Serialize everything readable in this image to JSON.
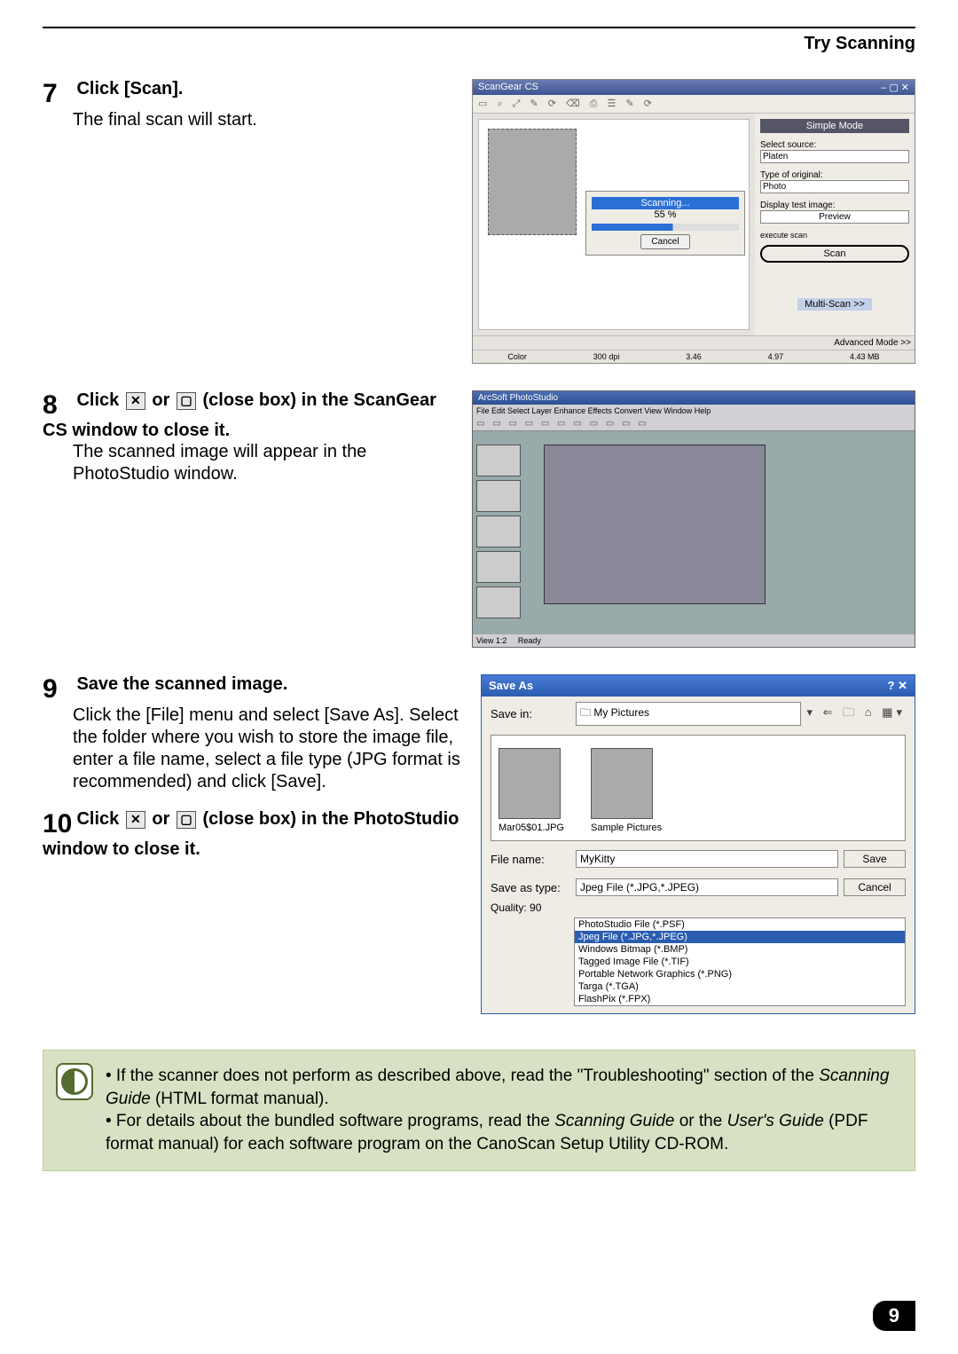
{
  "header": {
    "title": "Try Scanning"
  },
  "steps": {
    "s7": {
      "num": "7",
      "bold": "Click [Scan].",
      "body": "The final scan will start."
    },
    "s8": {
      "num": "8",
      "bold_a": "Click ",
      "bold_b": " or ",
      "bold_c": " (close box) in the ScanGear CS window to close it.",
      "body": "The scanned image will appear in the PhotoStudio window."
    },
    "s9": {
      "num": "9",
      "bold": "Save the scanned image.",
      "body": "Click the [File] menu and select [Save As]. Select the folder where you wish to store the image file, enter a file name, select a file type (JPG format is recommended) and click [Save]."
    },
    "s10": {
      "num": "10",
      "bold_a": "Click ",
      "bold_b": " or ",
      "bold_c": " (close box) in the PhotoStudio window to close it."
    }
  },
  "scangear": {
    "title": "ScanGear CS",
    "toolbar": "▭ ⌕ ⤢  ✎ ⟳ ⌫ ⎙ ☰ ✎ ⟳",
    "mode": "Simple Mode",
    "select_source_label": "Select source:",
    "select_source_value": "Platen",
    "type_original_label": "Type of original:",
    "type_original_value": "Photo",
    "display_label": "Display test image:",
    "preview_btn": "Preview",
    "scan_label": "execute scan",
    "scan_btn": "Scan",
    "multi_btn": "Multi-Scan >>",
    "advanced": "Advanced Mode >>",
    "progress_title": "Scanning...",
    "progress_pct": "55 %",
    "cancel": "Cancel",
    "status": {
      "color": "Color",
      "dpi": "300 dpi",
      "w": "3.46",
      "h": "4.97",
      "size": "4.43 MB"
    }
  },
  "photostudio": {
    "title": "ArcSoft PhotoStudio",
    "menu": "File  Edit  Select  Layer  Enhance  Effects  Convert  View  Window  Help",
    "status_left": "View 1:2",
    "status_ready": "Ready"
  },
  "saveas": {
    "title": "Save As",
    "savein_label": "Save in:",
    "savein_value": "My Pictures",
    "nav_icons": "▾  ⇐ 🗀 ⌂ ▦▾",
    "thumb1": "Mar05$01.JPG",
    "thumb2": "Sample Pictures",
    "filename_label": "File name:",
    "filename_value": "MyKitty",
    "savetype_label": "Save as type:",
    "savetype_value": "Jpeg File (*.JPG,*.JPEG)",
    "quality_label": "Quality: 90",
    "save_btn": "Save",
    "cancel_btn": "Cancel",
    "type_options": [
      "PhotoStudio File (*.PSF)",
      "Jpeg File (*.JPG,*.JPEG)",
      "Windows Bitmap (*.BMP)",
      "Tagged Image File (*.TIF)",
      "Portable Network Graphics (*.PNG)",
      "Targa (*.TGA)",
      "FlashPix (*.FPX)"
    ]
  },
  "note": {
    "bullet1_a": "• If the scanner does not perform as described above, read the \"Troubleshooting\" section of the ",
    "bullet1_em": "Scanning Guide",
    "bullet1_b": " (HTML format manual).",
    "bullet2_a": "• For details about the bundled software programs, read the ",
    "bullet2_em1": "Scanning Guide",
    "bullet2_b": " or the ",
    "bullet2_em2": "User's Guide",
    "bullet2_c": " (PDF format manual) for each software program on the CanoScan Setup Utility CD-ROM."
  },
  "page_number": "9"
}
